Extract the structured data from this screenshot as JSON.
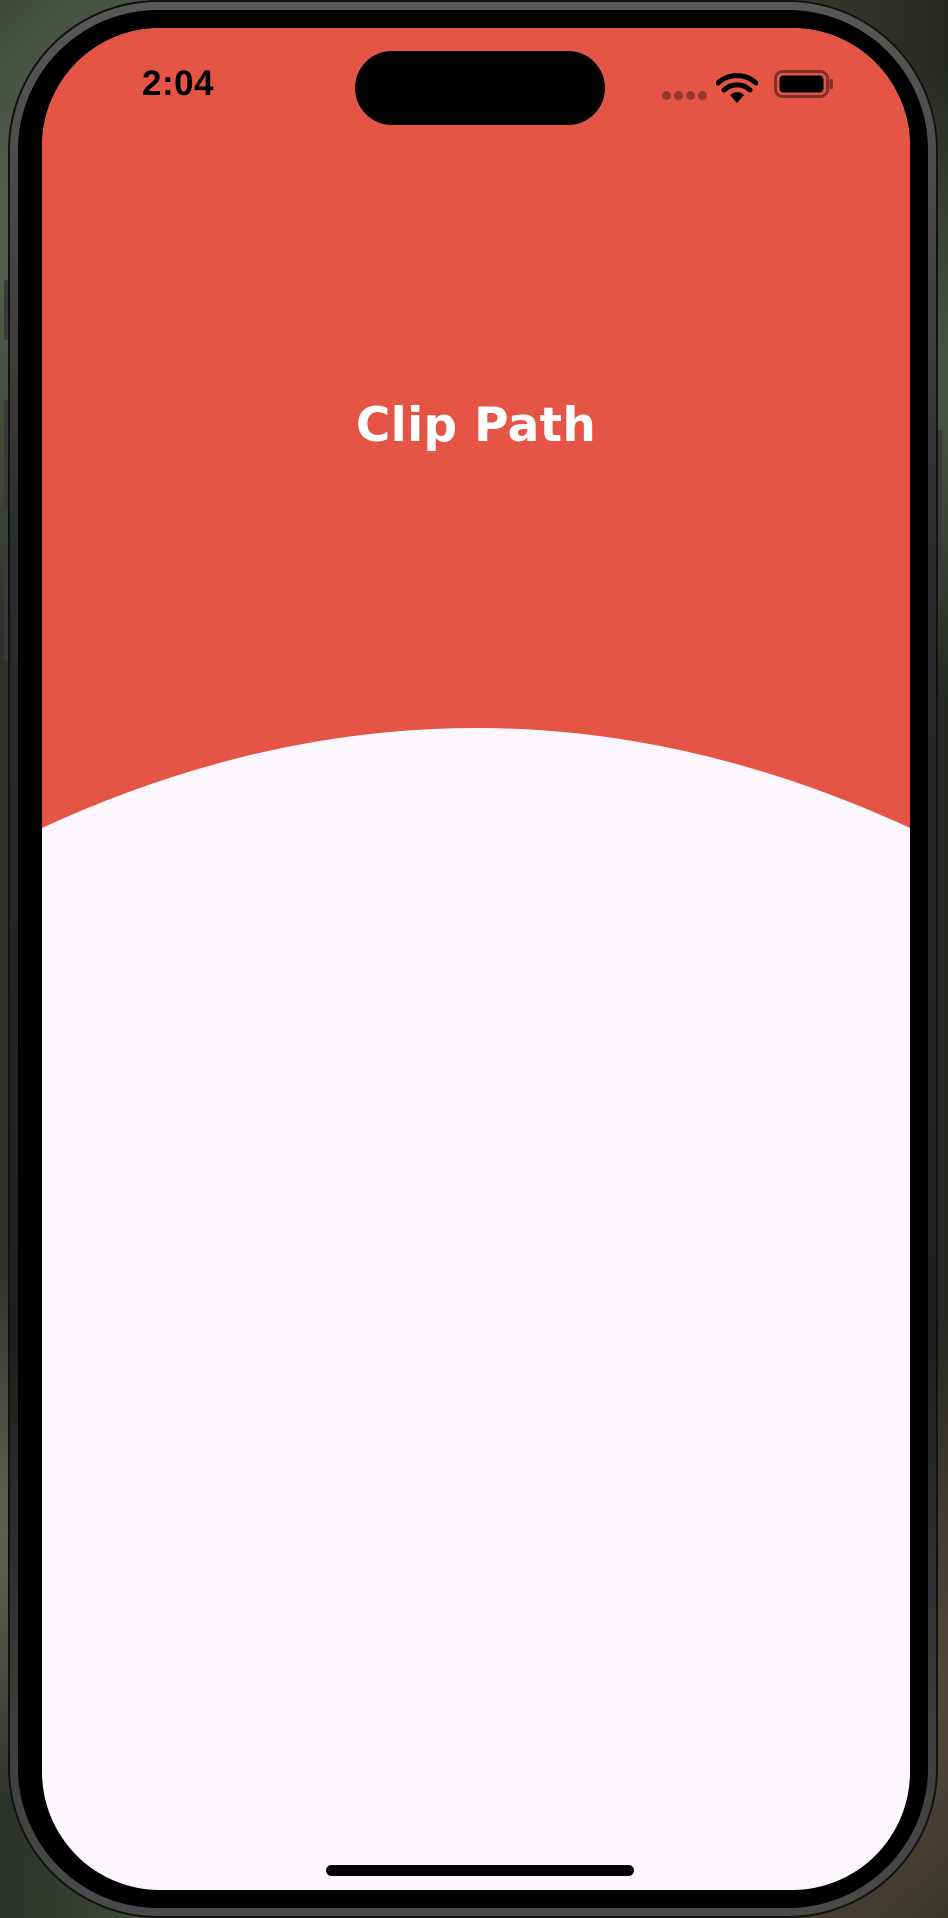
{
  "status_bar": {
    "time": "2:04",
    "signal_icon": "signal-dots-icon",
    "wifi_icon": "wifi-icon",
    "battery_icon": "battery-icon"
  },
  "header": {
    "title": "Clip Path",
    "background_color": "#E45545",
    "title_color": "#FFFFFF"
  },
  "body": {
    "background_color": "#FCF7FD"
  }
}
